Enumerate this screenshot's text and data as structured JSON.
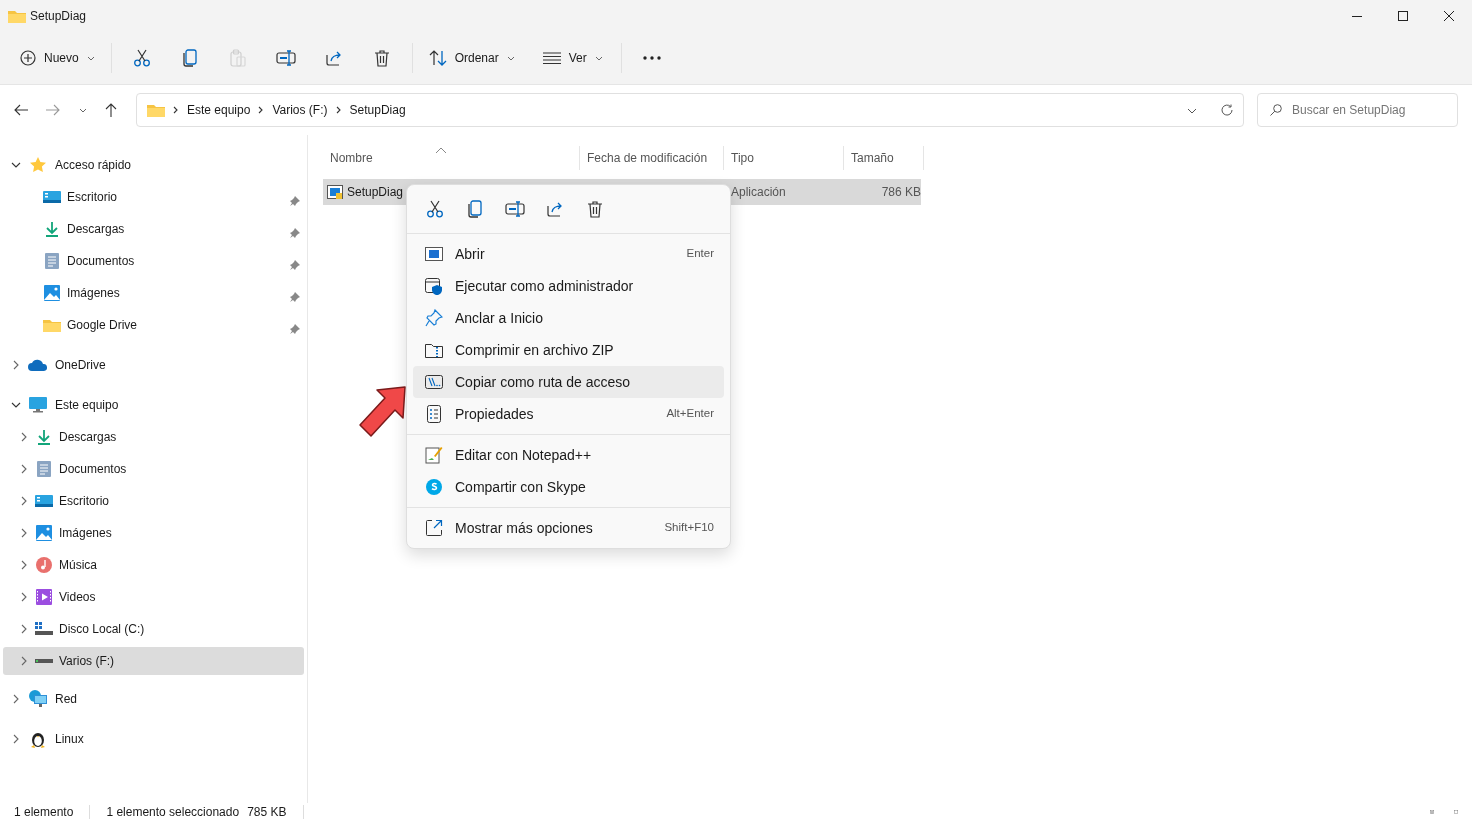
{
  "window": {
    "title": "SetupDiag"
  },
  "toolbar": {
    "new_label": "Nuevo",
    "actions": [
      {
        "disabled": false
      },
      {
        "disabled": false
      },
      {
        "disabled": true
      },
      {
        "disabled": false
      },
      {
        "disabled": false
      },
      {
        "disabled": false
      }
    ],
    "sort_label": "Ordenar",
    "view_label": "Ver"
  },
  "address": {
    "path": [
      "Este equipo",
      "Varios (F:)",
      "SetupDiag"
    ],
    "search_placeholder": "Buscar en SetupDiag"
  },
  "sidebar": {
    "items": [
      {
        "label": "Acceso rápido",
        "expanded": true,
        "selected": false,
        "children": [
          {
            "label": "Escritorio",
            "pinned": true,
            "selected": false
          },
          {
            "label": "Descargas",
            "pinned": true,
            "selected": false
          },
          {
            "label": "Documentos",
            "pinned": true,
            "selected": false
          },
          {
            "label": "Imágenes",
            "pinned": true,
            "selected": false
          },
          {
            "label": "Google Drive",
            "pinned": true,
            "selected": false
          }
        ]
      },
      {
        "label": "OneDrive",
        "expanded": false,
        "selected": false
      },
      {
        "label": "Este equipo",
        "expanded": true,
        "selected": false,
        "children": [
          {
            "label": "Descargas",
            "expanded": false,
            "selected": false
          },
          {
            "label": "Documentos",
            "expanded": false,
            "selected": false
          },
          {
            "label": "Escritorio",
            "expanded": false,
            "selected": false
          },
          {
            "label": "Imágenes",
            "expanded": false,
            "selected": false
          },
          {
            "label": "Música",
            "expanded": false,
            "selected": false
          },
          {
            "label": "Videos",
            "expanded": false,
            "selected": false
          },
          {
            "label": "Disco Local (C:)",
            "expanded": false,
            "selected": false
          },
          {
            "label": "Varios (F:)",
            "expanded": false,
            "selected": true
          }
        ]
      },
      {
        "label": "Red",
        "expanded": false,
        "selected": false
      },
      {
        "label": "Linux",
        "expanded": false,
        "selected": false
      }
    ]
  },
  "file_list": {
    "columns": [
      {
        "label": "Nombre",
        "sorted": true
      },
      {
        "label": "Fecha de modificación",
        "sorted": false
      },
      {
        "label": "Tipo",
        "sorted": false
      },
      {
        "label": "Tamaño",
        "sorted": false
      }
    ],
    "rows": [
      {
        "name": "SetupDiag",
        "type": "Aplicación",
        "size": "786 KB",
        "selected": true
      }
    ]
  },
  "context_menu": {
    "groups": [
      [
        {
          "label": "Abrir",
          "shortcut": "Enter",
          "highlighted": false
        },
        {
          "label": "Ejecutar como administrador",
          "highlighted": false
        },
        {
          "label": "Anclar a Inicio",
          "highlighted": false
        },
        {
          "label": "Comprimir en archivo ZIP",
          "highlighted": false
        },
        {
          "label": "Copiar como ruta de acceso",
          "highlighted": true
        },
        {
          "label": "Propiedades",
          "shortcut": "Alt+Enter",
          "highlighted": false
        }
      ],
      [
        {
          "label": "Editar con Notepad++",
          "highlighted": false
        },
        {
          "label": "Compartir con Skype",
          "highlighted": false
        }
      ],
      [
        {
          "label": "Mostrar más opciones",
          "shortcut": "Shift+F10",
          "highlighted": false
        }
      ]
    ]
  },
  "status_bar": {
    "count": "1 elemento",
    "selection": "1 elemento seleccionado",
    "size": "785 KB"
  }
}
